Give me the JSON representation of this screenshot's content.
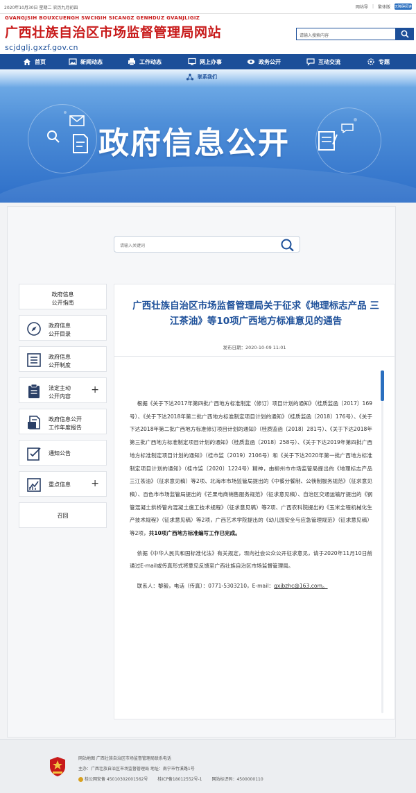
{
  "topbar": {
    "date": "2020年10月30日 星期二 农历九月初四",
    "links": [
      "网站导",
      "繁体版"
    ],
    "barrier": "无障碍阅读"
  },
  "header": {
    "zhuang": "GVANGJSIH BOUXCUENGH SWCIGIH SICANGZ GENHDUZ GVANJLIGIZ",
    "title": "广西壮族自治区市场监督管理局网站",
    "domain": "scjdglj.gxzf.gov.cn",
    "search_placeholder": "请输入搜索内容"
  },
  "nav": [
    {
      "label": "首页",
      "icon": "home-icon"
    },
    {
      "label": "新闻动态",
      "icon": "image-icon"
    },
    {
      "label": "工作动态",
      "icon": "printer-icon"
    },
    {
      "label": "网上办事",
      "icon": "monitor-icon"
    },
    {
      "label": "政务公开",
      "icon": "eye-icon"
    },
    {
      "label": "互动交流",
      "icon": "chat-icon"
    },
    {
      "label": "专题",
      "icon": "settings-icon"
    }
  ],
  "banner": {
    "contact": "联系我们",
    "title": "政府信息公开"
  },
  "mid_search": {
    "placeholder": "请输入关键词"
  },
  "sidebar": [
    {
      "label_lines": [
        "政府信息",
        "公开指南"
      ],
      "icon": "none",
      "plus": ""
    },
    {
      "label_lines": [
        "政府信息",
        "公开目录"
      ],
      "icon": "compass-icon",
      "plus": ""
    },
    {
      "label_lines": [
        "政府信息",
        "公开制度"
      ],
      "icon": "list-icon",
      "plus": ""
    },
    {
      "label_lines": [
        "法定主动",
        "公开内容"
      ],
      "icon": "clipboard-icon",
      "plus": "+"
    },
    {
      "label_lines": [
        "政府信息公开",
        "工作年度报告"
      ],
      "icon": "report-icon",
      "plus": ""
    },
    {
      "label_lines": [
        "通知公告"
      ],
      "icon": "notice-icon",
      "plus": ""
    },
    {
      "label_lines": [
        "重点信息"
      ],
      "icon": "chart-icon",
      "plus": "+"
    },
    {
      "label_lines": [
        "召回"
      ],
      "icon": "none",
      "plus": ""
    }
  ],
  "article": {
    "title": "广西壮族自治区市场监督管理局关于征求《地理标志产品 三江茶油》等10项广西地方标准意见的通告",
    "date_label": "发布日期：",
    "date": "2020-10-09 11:01",
    "para1": "根据《关于下达2017年第四批广西地方标准制定（修订）项目计划的通知》（桂质监函〔2017〕169号）、《关于下达2018年第二批广西地方标准制定项目计划的通知》（桂质监函〔2018〕176号）、《关于下达2018年第二批广西地方标准修订项目计划的通知》（桂质监函〔2018〕281号）、《关于下达2018年第三批广西地方标准制定项目计划的通知》（桂质监函〔2018〕258号）、《关于下达2019年第四批广西地方标准制定项目计划的通知》（桂市监〔2019〕2106号）和《关于下达2020年第一批广西地方标准制定项目计划的通知》（桂市监〔2020〕1224号）精神，由柳州市市场监管局提出的《地理标志产品　三江茶油》（征求意见稿）等2项、北海市市场监管局提出的《中餐分餐制、公筷制服务规范》（征求意见稿）、百色市市场监管局提出的《芒果电商销售服务规范》（征求意见稿）、自治区交通运输厅提出的《钢管混凝土拱桥管内混凝土施工技术规程》（征求意见稿）等2项、广西农科院提出的《玉米全程机械化生产技术规程》（征求意见稿）等2项，广西艺术学院提出的《幼儿园安全与应急管理规范》（征求意见稿）等2项，",
    "para1_bold": "共10项广西地方标准编写工作已完成。",
    "para2": "依据《中华人民共和国标准化法》有关规定，现向社会公众公开征求意见，请于2020年11月10日前通过E-mail或传真形式将意见反馈至广西壮族自治区市场监督管理局。",
    "para3": "联系人：黎毅，电话（传真）：0771-5303210，E-mail：",
    "email": "gxjbzhc@163.com。"
  },
  "footer": {
    "line1": "网站地图  广西壮族自治区市场监督管理局联系电话",
    "line2": "主办：广西壮族自治区市场监督管理局  地址：南宁市竹溪路1号",
    "gongan": "桂公网安备 45010302001562号",
    "icp": "桂ICP备18012552号-1",
    "sitecode": "网站标识码：4500000110"
  },
  "colors": {
    "brand_red": "#c81a1a",
    "brand_blue": "#1c4f99"
  }
}
